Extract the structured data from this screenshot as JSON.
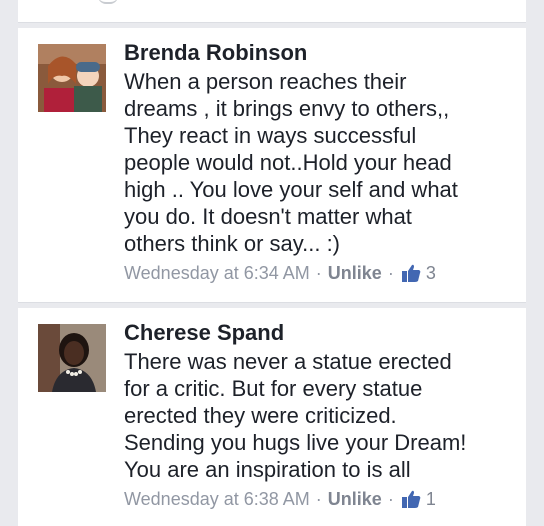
{
  "comments": [
    {
      "author": "Brenda Robinson",
      "text": "When a person reaches their\ndreams , it brings envy to others,,\nThey react in ways successful\npeople would not..Hold your head\nhigh .. You love your self and what\nyou do. It doesn't matter what\nothers think or say... :)",
      "timestamp": "Wednesday at 6:34 AM",
      "action": "Unlike",
      "likes": "3"
    },
    {
      "author": "Cherese Spand",
      "text": "There was never a statue erected\nfor a critic. But for every statue\nerected they were criticized.\nSending you hugs live your Dream!\nYou are an inspiration to is all",
      "timestamp": "Wednesday at 6:38 AM",
      "action": "Unlike",
      "likes": "1"
    }
  ],
  "separator": "·",
  "icons": {
    "like": "thumbs-up-icon"
  },
  "colors": {
    "like_blue": "#4267b2",
    "meta_gray": "#9197a3",
    "text": "#1d2129"
  }
}
